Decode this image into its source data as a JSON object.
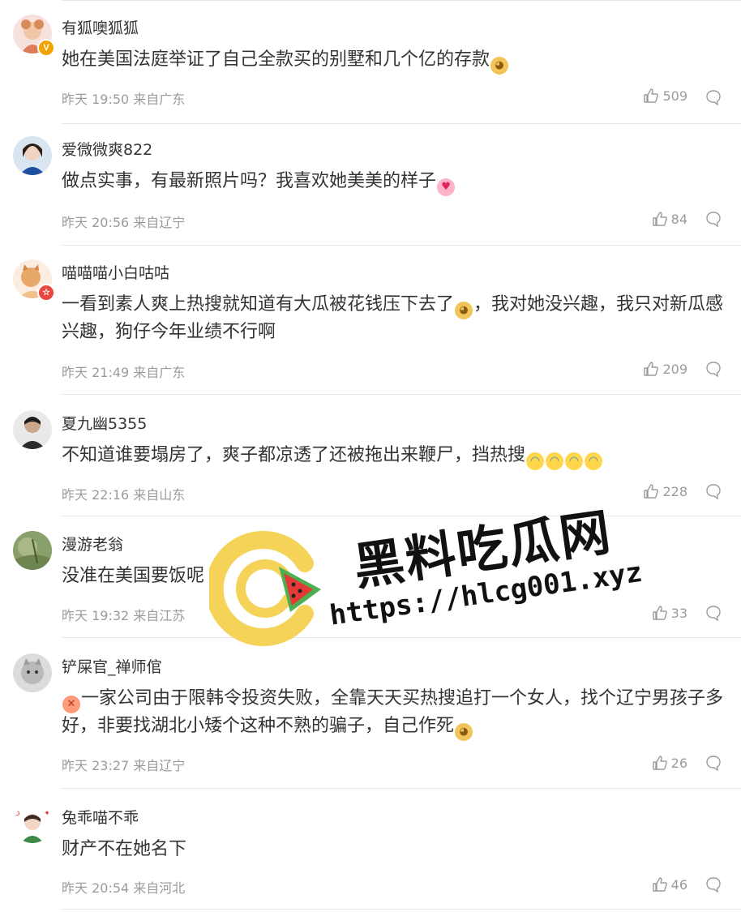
{
  "comments": [
    {
      "username": "有狐噢狐狐",
      "text_pre": "她在美国法庭举证了自己全款买的别墅和几个亿的存款",
      "text_post": "",
      "emojis": [
        "doge"
      ],
      "meta": "昨天 19:50 来自广东",
      "likes": "509",
      "badge": "V"
    },
    {
      "username": "爱微微爽822",
      "text_pre": "做点实事，有最新照片吗？我喜欢她美美的样子",
      "text_post": "",
      "emojis": [
        "heart-eyes"
      ],
      "meta": "昨天 20:56 来自辽宁",
      "likes": "84",
      "badge": ""
    },
    {
      "username": "喵喵喵小白咕咕",
      "text_pre": "一看到素人爽上热搜就知道有大瓜被花钱压下去了",
      "text_post": "，我对她没兴趣，我只对新瓜感兴趣，狗仔今年业绩不行啊",
      "emojis": [
        "doge"
      ],
      "meta": "昨天 21:49 来自广东",
      "likes": "209",
      "badge": "☆"
    },
    {
      "username": "夏九幽5355",
      "text_pre": "不知道谁要塌房了，爽子都凉透了还被拖出来鞭尸，挡热搜",
      "text_post": "",
      "emojis": [
        "laugh-cry",
        "laugh-cry",
        "laugh-cry",
        "laugh-cry"
      ],
      "meta": "昨天 22:16 来自山东",
      "likes": "228",
      "badge": ""
    },
    {
      "username": "漫游老翁",
      "text_pre": "没准在美国要饭呢",
      "text_post": "",
      "emojis": [],
      "meta": "昨天 19:32 来自江苏",
      "likes": "33",
      "badge": ""
    },
    {
      "username": "铲屎官_禅师倌",
      "text_pre": "",
      "text_post": "一家公司由于限韩令投资失败，全靠天天买热搜追打一个女人，找个辽宁男孩子多好，非要找湖北小矮个这种不熟的骗子，自己作死",
      "emojis": [
        "angry"
      ],
      "end_emojis": [
        "doge"
      ],
      "meta": "昨天 23:27 来自辽宁",
      "likes": "26",
      "badge": ""
    },
    {
      "username": "兔乖喵不乖",
      "text_pre": "财产不在她名下",
      "text_post": "",
      "emojis": [],
      "meta": "昨天 20:54 来自河北",
      "likes": "46",
      "badge": ""
    }
  ],
  "watermark": {
    "title": "黑料吃瓜网",
    "url": "https://hlcg001.xyz"
  },
  "icons": {
    "like": "thumbs-up-icon",
    "reply": "comment-bubble-icon",
    "emoji_doge": "doge-emoji-icon",
    "emoji_heart_eyes": "heart-eyes-emoji-icon",
    "emoji_laugh_cry": "laugh-cry-emoji-icon",
    "emoji_angry": "angry-emoji-icon"
  },
  "colors": {
    "meta_gray": "#9b9b9b",
    "text": "#333333",
    "badge_orange": "#f2a300",
    "badge_red": "#e9463f"
  }
}
